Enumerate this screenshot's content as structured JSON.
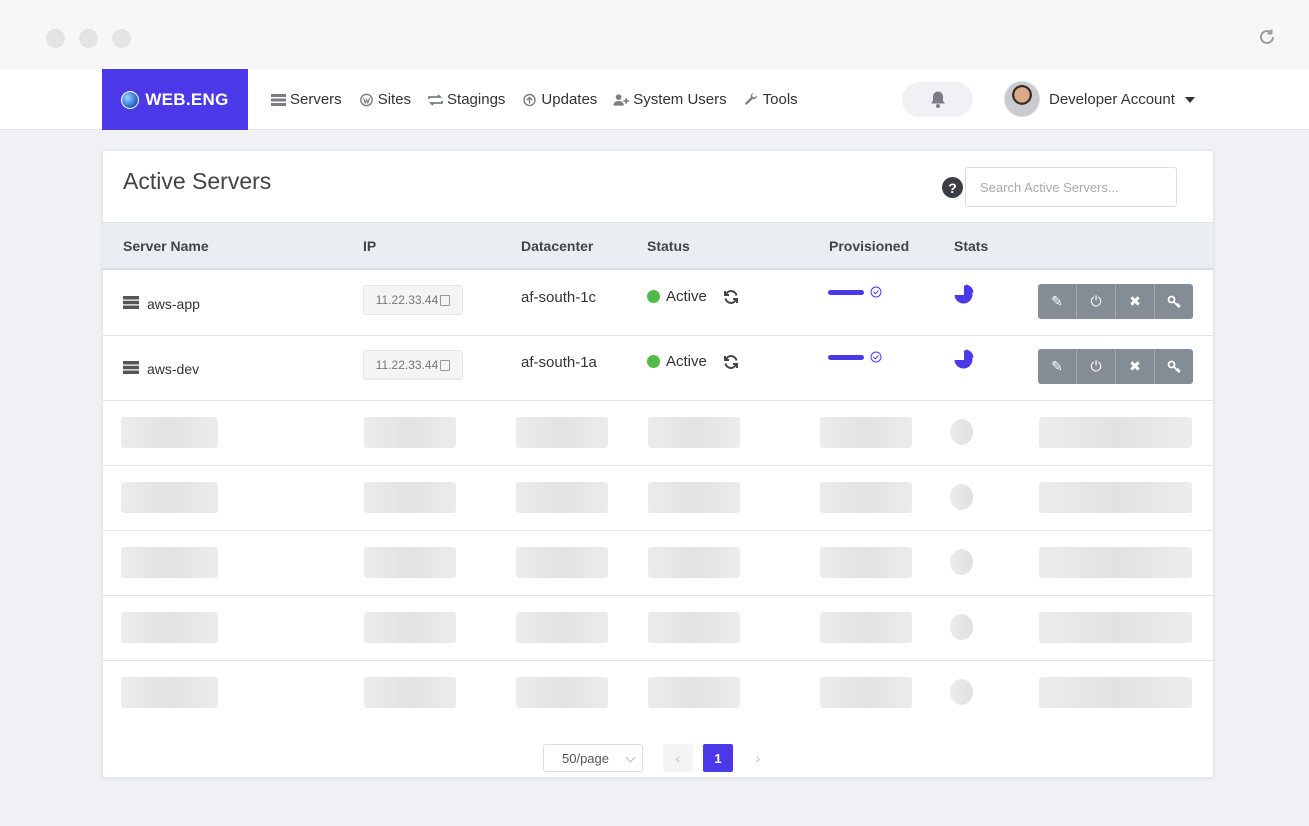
{
  "app": {
    "logo_text": "WEB.ENG",
    "nav": [
      {
        "label": "Servers",
        "icon": "servers-icon"
      },
      {
        "label": "Sites",
        "icon": "wordpress-icon"
      },
      {
        "label": "Stagings",
        "icon": "sync-arrows-icon"
      },
      {
        "label": "Updates",
        "icon": "update-arrow-icon"
      },
      {
        "label": "System Users",
        "icon": "user-plus-icon"
      },
      {
        "label": "Tools",
        "icon": "wrench-icon"
      }
    ],
    "account_label": "Developer Account"
  },
  "card": {
    "title": "Active Servers",
    "search_placeholder": "Search Active Servers...",
    "columns": [
      "Server Name",
      "IP",
      "Datacenter",
      "Status",
      "Provisioned",
      "Stats"
    ],
    "rows": [
      {
        "name": "aws-app",
        "ip": "11.22.33.44",
        "datacenter": "af-south-1c",
        "status": "Active",
        "provisioned": 1.0
      },
      {
        "name": "aws-dev",
        "ip": "11.22.33.44",
        "datacenter": "af-south-1a",
        "status": "Active",
        "provisioned": 1.0
      }
    ]
  },
  "pagination": {
    "per_page": "50/page",
    "current_page": "1"
  },
  "colors": {
    "brand": "#4b38e8",
    "status_active": "#52b94b",
    "action_button": "#848c95"
  }
}
